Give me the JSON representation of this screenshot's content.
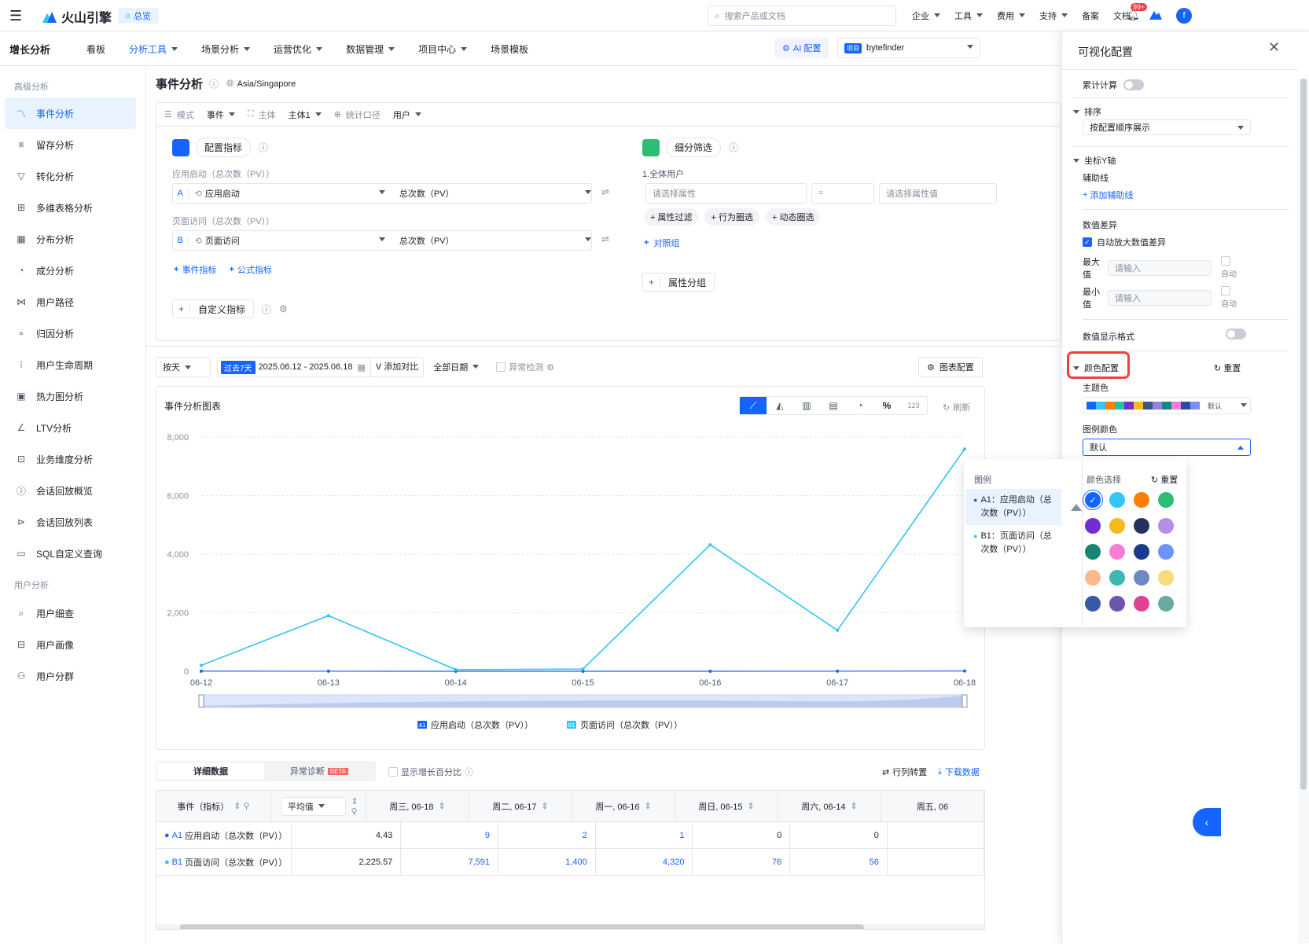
{
  "topbar": {
    "brand": "火山引擎",
    "home_label": "总览",
    "search_placeholder": "搜索产品或文档",
    "menu": [
      "企业",
      "工具",
      "费用",
      "支持",
      "备案",
      "文档"
    ],
    "badge": "99+",
    "avatar_letter": "f"
  },
  "subnav": {
    "title": "增长分析",
    "items": [
      "看板",
      "分析工具",
      "场景分析",
      "运营优化",
      "数据管理",
      "项目中心",
      "场景模板"
    ],
    "ai_button": "AI 配置",
    "project_tag": "项目",
    "project_name": "bytefinder"
  },
  "sidebar": {
    "group1": "高级分析",
    "items1": [
      "事件分析",
      "留存分析",
      "转化分析",
      "多维表格分析",
      "分布分析",
      "成分分析",
      "用户路径",
      "归因分析",
      "用户生命周期",
      "热力图分析",
      "LTV分析",
      "业务维度分析",
      "会话回放概览",
      "会话回放列表",
      "SQL自定义查询"
    ],
    "group2": "用户分析",
    "items2": [
      "用户细查",
      "用户画像",
      "用户分群"
    ]
  },
  "page": {
    "title": "事件分析",
    "timezone": "Asia/Singapore"
  },
  "modebar": {
    "mode_label": "模式",
    "mode_value": "事件",
    "subject_label": "主体",
    "subject_value": "主体1",
    "caliber_label": "统计口径",
    "caliber_value": "用户"
  },
  "metrics": {
    "config_title": "配置指标",
    "a_caption": "应用启动（总次数（PV））",
    "a_letter": "A",
    "a_event": "应用启动",
    "a_measure": "总次数（PV）",
    "b_caption": "页面访问（总次数（PV））",
    "b_letter": "B",
    "b_event": "页面访问",
    "b_measure": "总次数（PV）",
    "add_event": "事件指标",
    "add_formula": "公式指标",
    "custom": "自定义指标"
  },
  "filter": {
    "title": "细分筛选",
    "subject": "1.全体用户",
    "attr_placeholder": "请选择属性",
    "eq": "=",
    "value_placeholder": "请选择属性值",
    "btn1": "属性过滤",
    "btn2": "行为圈选",
    "btn3": "动态圈选",
    "compare": "对照组",
    "group": "属性分组"
  },
  "timebar": {
    "granularity": "按天",
    "range_tag": "过去7天",
    "range": "2025.06.12 - 2025.06.18",
    "compare": "添加对比",
    "date_type": "全部日期",
    "anomaly": "异常检测",
    "chart_config": "图表配置"
  },
  "chart_card": {
    "title": "事件分析图表",
    "refresh": "刷新",
    "tb_pct": "%",
    "tb_num": "123"
  },
  "chart_data": {
    "type": "line",
    "categories": [
      "06-12",
      "06-13",
      "06-14",
      "06-15",
      "06-16",
      "06-17",
      "06-18"
    ],
    "ylim": [
      0,
      8000
    ],
    "yticks": [
      "8,000",
      "6,000",
      "4,000",
      "2,000",
      "0"
    ],
    "series": [
      {
        "name": "应用启动（总次数（PV））",
        "badge": "A1",
        "color": "#1664ff",
        "values": [
          3,
          2,
          0,
          0,
          1,
          2,
          9
        ]
      },
      {
        "name": "页面访问（总次数（PV））",
        "badge": "B1",
        "color": "#32c5f5",
        "values": [
          200,
          1900,
          56,
          76,
          4320,
          1400,
          7591
        ]
      }
    ]
  },
  "table": {
    "tab1": "详细数据",
    "tab2": "异常诊断",
    "beta": "BETA",
    "growth": "显示增长百分比",
    "pivot": "行列转置",
    "download": "下载数据",
    "col_event": "事件（指标）",
    "avg": "平均值",
    "cols": [
      "周三, 06-18",
      "周二, 06-17",
      "周一, 06-16",
      "周日, 06-15",
      "周六, 06-14",
      "周五, 06"
    ],
    "rows": [
      {
        "letter": "A1",
        "name": "应用启动（总次数（PV））",
        "avg": "4.43",
        "vals": [
          "9",
          "2",
          "1",
          "0",
          "0"
        ]
      },
      {
        "letter": "B1",
        "name": "页面访问（总次数（PV））",
        "avg": "2,225.57",
        "vals": [
          "7,591",
          "1,400",
          "4,320",
          "76",
          "56"
        ]
      }
    ]
  },
  "panel": {
    "title": "可视化配置",
    "cumulative": "累计计算",
    "sort_title": "排序",
    "sort_value": "按配置顺序展示",
    "yaxis_title": "坐标Y轴",
    "aux_line": "辅助线",
    "add_aux": "添加辅助线",
    "diff": "数值差异",
    "auto_zoom": "自动放大数值差异",
    "max_label": "最大值",
    "min_label": "最小值",
    "input_placeholder": "请输入",
    "auto": "自动",
    "display_format": "数值显示格式",
    "color_title": "颜色配置",
    "reset": "重置",
    "theme": "主题色",
    "default": "默认",
    "legend_color": "图例颜色",
    "theme_colors": [
      "#1664ff",
      "#32c5f5",
      "#ff7d00",
      "#14c9a8",
      "#722ed1",
      "#f7ba1e",
      "#3c5585",
      "#9a7ee8",
      "#168680",
      "#f77ed7",
      "#2a4fa0",
      "#7a8ef9"
    ]
  },
  "popup": {
    "legend_title": "图例",
    "items": [
      {
        "text": "A1：应用启动（总次数（PV））",
        "color": "#1664ff"
      },
      {
        "text": "B1：页面访问（总次数（PV））",
        "color": "#32c5f5"
      }
    ],
    "colors_title": "颜色选择",
    "reset": "重置",
    "colors": [
      "#1664ff",
      "#32c5f5",
      "#ff7d00",
      "#2dbd73",
      "#722ed1",
      "#f7ba1e",
      "#24335d",
      "#b58ee8",
      "#168673",
      "#f77ed7",
      "#1b3a8f",
      "#6c94f9",
      "#f9b98c",
      "#3cb7b1",
      "#6f88c4",
      "#f8dc7a",
      "#3a58a8",
      "#6c55ad",
      "#df4291",
      "#6aa9a2"
    ]
  }
}
